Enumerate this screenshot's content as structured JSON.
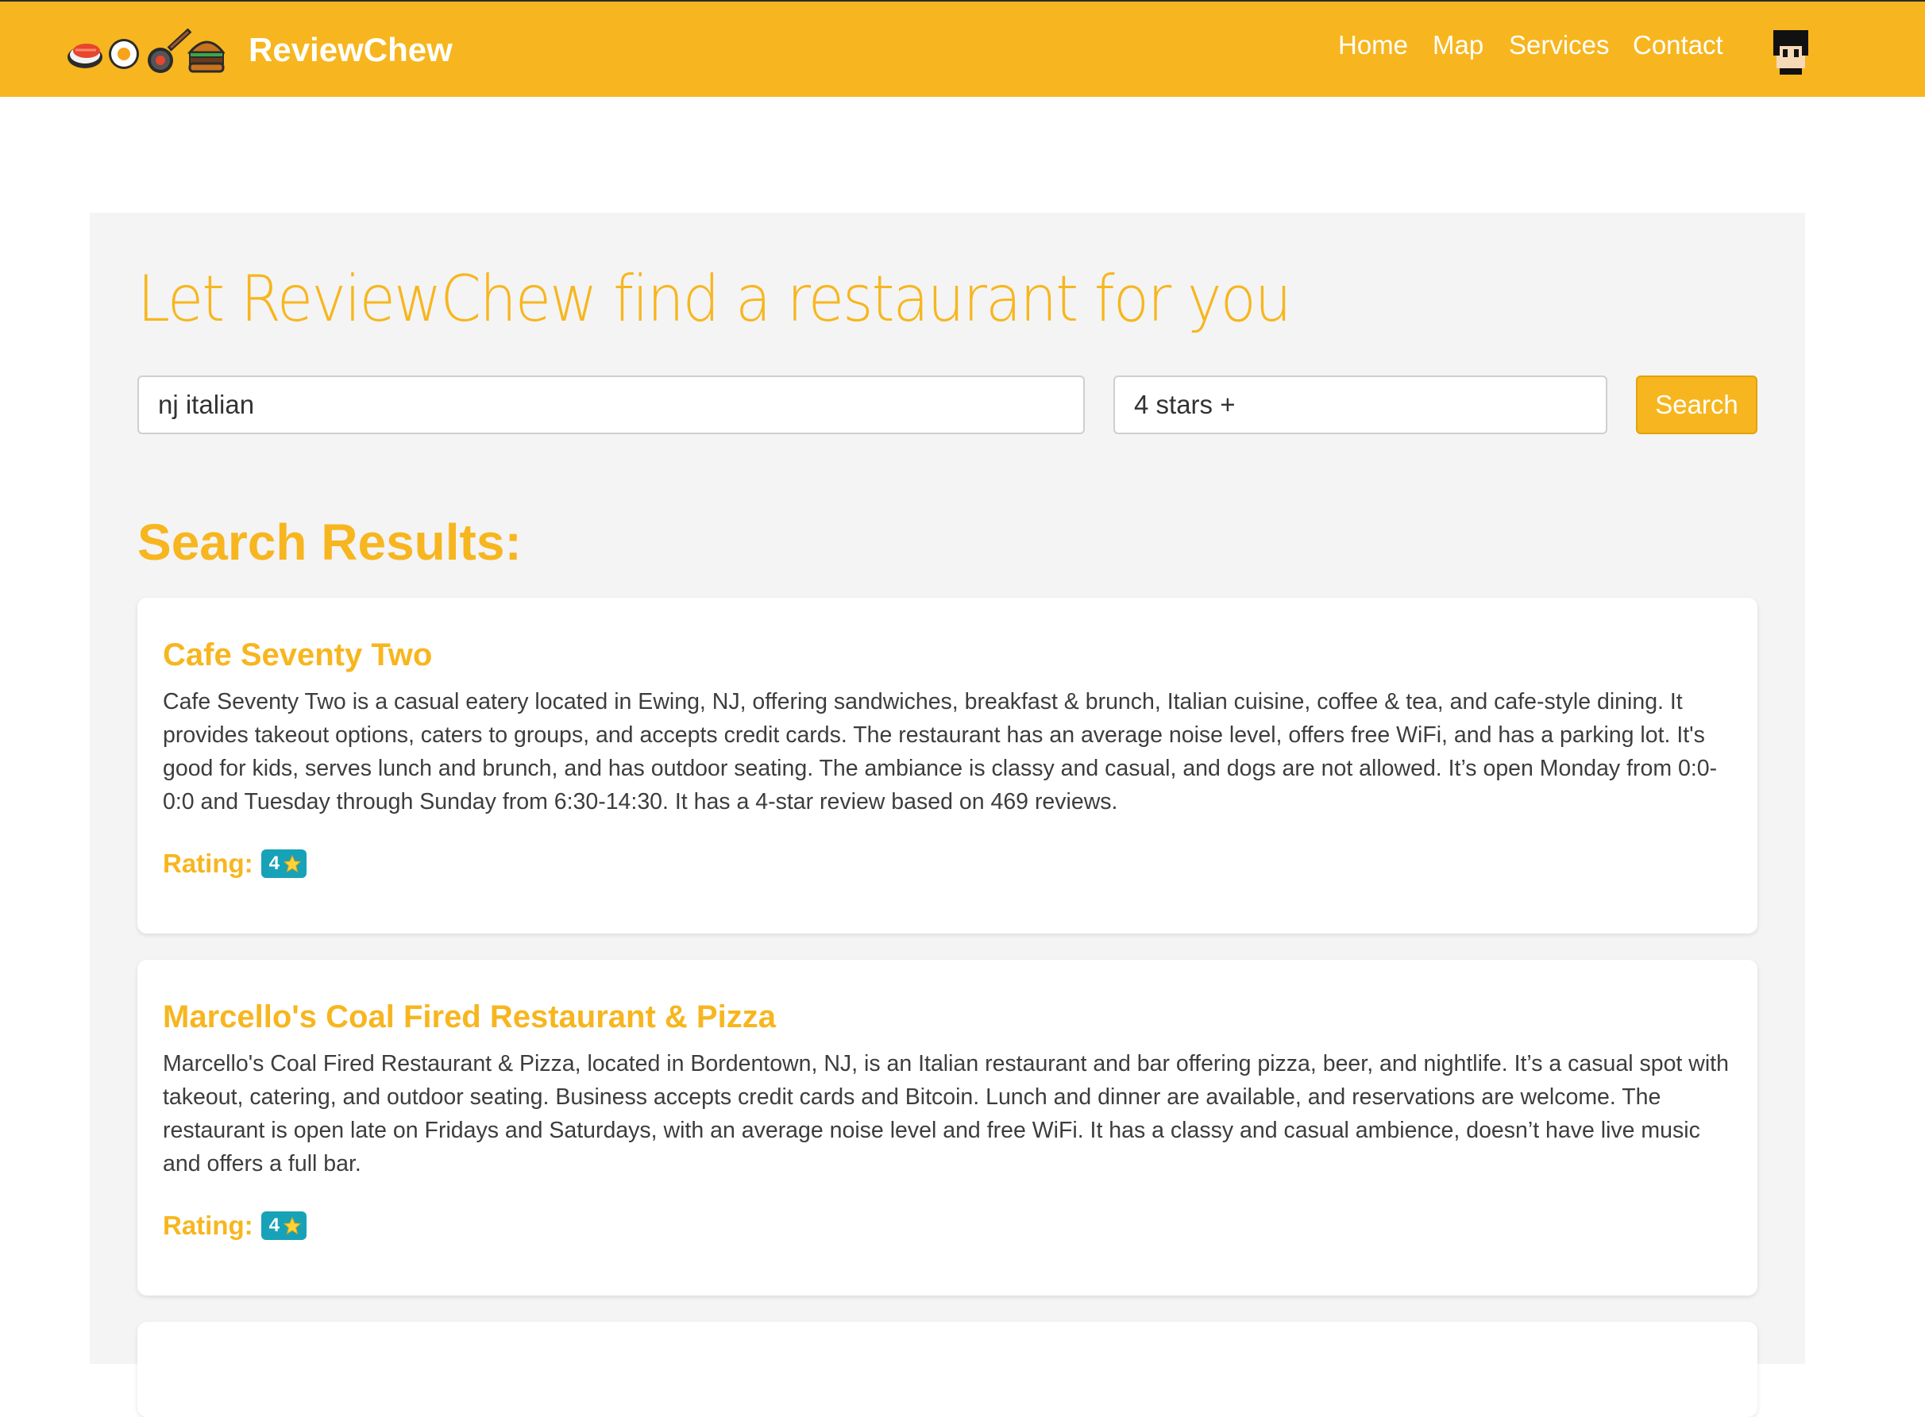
{
  "header": {
    "brand": "ReviewChew",
    "nav": [
      "Home",
      "Map",
      "Services",
      "Contact"
    ],
    "brand_icons": [
      "sushi-icon",
      "fried-egg-icon",
      "frying-pan-icon",
      "burger-icon"
    ]
  },
  "search": {
    "title": "Let ReviewChew find a restaurant for you",
    "query_value": "nj italian",
    "rating_value": "4 stars +",
    "button_label": "Search"
  },
  "results": {
    "heading": "Search Results:",
    "rating_label": "Rating:",
    "items": [
      {
        "name": "Cafe Seventy Two",
        "description": "Cafe Seventy Two is a casual eatery located in Ewing, NJ, offering sandwiches, breakfast & brunch, Italian cuisine, coffee & tea, and cafe-style dining. It provides takeout options, caters to groups, and accepts credit cards. The restaurant has an average noise level, offers free WiFi, and has a parking lot. It's good for kids, serves lunch and brunch, and has outdoor seating. The ambiance is classy and casual, and dogs are not allowed. It’s open Monday from 0:0-0:0 and Tuesday through Sunday from 6:30-14:30. It has a 4-star review based on 469 reviews.",
        "rating": "4"
      },
      {
        "name": "Marcello's Coal Fired Restaurant & Pizza",
        "description": "Marcello's Coal Fired Restaurant & Pizza, located in Bordentown, NJ, is an Italian restaurant and bar offering pizza, beer, and nightlife. It’s a casual spot with takeout, catering, and outdoor seating. Business accepts credit cards and Bitcoin. Lunch and dinner are available, and reservations are welcome. The restaurant is open late on Fridays and Saturdays, with an average noise level and free WiFi. It has a classy and casual ambience, doesn’t have live music and offers a full bar.",
        "rating": "4"
      }
    ]
  },
  "colors": {
    "accent": "#f7b61f",
    "badge": "#17a2b8",
    "panel_bg": "#f4f4f4"
  }
}
